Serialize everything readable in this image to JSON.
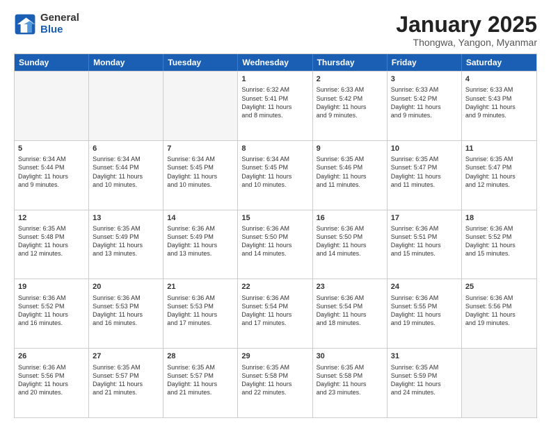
{
  "logo": {
    "general": "General",
    "blue": "Blue"
  },
  "title": "January 2025",
  "location": "Thongwa, Yangon, Myanmar",
  "header_days": [
    "Sunday",
    "Monday",
    "Tuesday",
    "Wednesday",
    "Thursday",
    "Friday",
    "Saturday"
  ],
  "weeks": [
    [
      {
        "day": "",
        "lines": [],
        "empty": true
      },
      {
        "day": "",
        "lines": [],
        "empty": true
      },
      {
        "day": "",
        "lines": [],
        "empty": true
      },
      {
        "day": "1",
        "lines": [
          "Sunrise: 6:32 AM",
          "Sunset: 5:41 PM",
          "Daylight: 11 hours",
          "and 8 minutes."
        ],
        "empty": false
      },
      {
        "day": "2",
        "lines": [
          "Sunrise: 6:33 AM",
          "Sunset: 5:42 PM",
          "Daylight: 11 hours",
          "and 9 minutes."
        ],
        "empty": false
      },
      {
        "day": "3",
        "lines": [
          "Sunrise: 6:33 AM",
          "Sunset: 5:42 PM",
          "Daylight: 11 hours",
          "and 9 minutes."
        ],
        "empty": false
      },
      {
        "day": "4",
        "lines": [
          "Sunrise: 6:33 AM",
          "Sunset: 5:43 PM",
          "Daylight: 11 hours",
          "and 9 minutes."
        ],
        "empty": false
      }
    ],
    [
      {
        "day": "5",
        "lines": [
          "Sunrise: 6:34 AM",
          "Sunset: 5:44 PM",
          "Daylight: 11 hours",
          "and 9 minutes."
        ],
        "empty": false
      },
      {
        "day": "6",
        "lines": [
          "Sunrise: 6:34 AM",
          "Sunset: 5:44 PM",
          "Daylight: 11 hours",
          "and 10 minutes."
        ],
        "empty": false
      },
      {
        "day": "7",
        "lines": [
          "Sunrise: 6:34 AM",
          "Sunset: 5:45 PM",
          "Daylight: 11 hours",
          "and 10 minutes."
        ],
        "empty": false
      },
      {
        "day": "8",
        "lines": [
          "Sunrise: 6:34 AM",
          "Sunset: 5:45 PM",
          "Daylight: 11 hours",
          "and 10 minutes."
        ],
        "empty": false
      },
      {
        "day": "9",
        "lines": [
          "Sunrise: 6:35 AM",
          "Sunset: 5:46 PM",
          "Daylight: 11 hours",
          "and 11 minutes."
        ],
        "empty": false
      },
      {
        "day": "10",
        "lines": [
          "Sunrise: 6:35 AM",
          "Sunset: 5:47 PM",
          "Daylight: 11 hours",
          "and 11 minutes."
        ],
        "empty": false
      },
      {
        "day": "11",
        "lines": [
          "Sunrise: 6:35 AM",
          "Sunset: 5:47 PM",
          "Daylight: 11 hours",
          "and 12 minutes."
        ],
        "empty": false
      }
    ],
    [
      {
        "day": "12",
        "lines": [
          "Sunrise: 6:35 AM",
          "Sunset: 5:48 PM",
          "Daylight: 11 hours",
          "and 12 minutes."
        ],
        "empty": false
      },
      {
        "day": "13",
        "lines": [
          "Sunrise: 6:35 AM",
          "Sunset: 5:49 PM",
          "Daylight: 11 hours",
          "and 13 minutes."
        ],
        "empty": false
      },
      {
        "day": "14",
        "lines": [
          "Sunrise: 6:36 AM",
          "Sunset: 5:49 PM",
          "Daylight: 11 hours",
          "and 13 minutes."
        ],
        "empty": false
      },
      {
        "day": "15",
        "lines": [
          "Sunrise: 6:36 AM",
          "Sunset: 5:50 PM",
          "Daylight: 11 hours",
          "and 14 minutes."
        ],
        "empty": false
      },
      {
        "day": "16",
        "lines": [
          "Sunrise: 6:36 AM",
          "Sunset: 5:50 PM",
          "Daylight: 11 hours",
          "and 14 minutes."
        ],
        "empty": false
      },
      {
        "day": "17",
        "lines": [
          "Sunrise: 6:36 AM",
          "Sunset: 5:51 PM",
          "Daylight: 11 hours",
          "and 15 minutes."
        ],
        "empty": false
      },
      {
        "day": "18",
        "lines": [
          "Sunrise: 6:36 AM",
          "Sunset: 5:52 PM",
          "Daylight: 11 hours",
          "and 15 minutes."
        ],
        "empty": false
      }
    ],
    [
      {
        "day": "19",
        "lines": [
          "Sunrise: 6:36 AM",
          "Sunset: 5:52 PM",
          "Daylight: 11 hours",
          "and 16 minutes."
        ],
        "empty": false
      },
      {
        "day": "20",
        "lines": [
          "Sunrise: 6:36 AM",
          "Sunset: 5:53 PM",
          "Daylight: 11 hours",
          "and 16 minutes."
        ],
        "empty": false
      },
      {
        "day": "21",
        "lines": [
          "Sunrise: 6:36 AM",
          "Sunset: 5:53 PM",
          "Daylight: 11 hours",
          "and 17 minutes."
        ],
        "empty": false
      },
      {
        "day": "22",
        "lines": [
          "Sunrise: 6:36 AM",
          "Sunset: 5:54 PM",
          "Daylight: 11 hours",
          "and 17 minutes."
        ],
        "empty": false
      },
      {
        "day": "23",
        "lines": [
          "Sunrise: 6:36 AM",
          "Sunset: 5:54 PM",
          "Daylight: 11 hours",
          "and 18 minutes."
        ],
        "empty": false
      },
      {
        "day": "24",
        "lines": [
          "Sunrise: 6:36 AM",
          "Sunset: 5:55 PM",
          "Daylight: 11 hours",
          "and 19 minutes."
        ],
        "empty": false
      },
      {
        "day": "25",
        "lines": [
          "Sunrise: 6:36 AM",
          "Sunset: 5:56 PM",
          "Daylight: 11 hours",
          "and 19 minutes."
        ],
        "empty": false
      }
    ],
    [
      {
        "day": "26",
        "lines": [
          "Sunrise: 6:36 AM",
          "Sunset: 5:56 PM",
          "Daylight: 11 hours",
          "and 20 minutes."
        ],
        "empty": false
      },
      {
        "day": "27",
        "lines": [
          "Sunrise: 6:35 AM",
          "Sunset: 5:57 PM",
          "Daylight: 11 hours",
          "and 21 minutes."
        ],
        "empty": false
      },
      {
        "day": "28",
        "lines": [
          "Sunrise: 6:35 AM",
          "Sunset: 5:57 PM",
          "Daylight: 11 hours",
          "and 21 minutes."
        ],
        "empty": false
      },
      {
        "day": "29",
        "lines": [
          "Sunrise: 6:35 AM",
          "Sunset: 5:58 PM",
          "Daylight: 11 hours",
          "and 22 minutes."
        ],
        "empty": false
      },
      {
        "day": "30",
        "lines": [
          "Sunrise: 6:35 AM",
          "Sunset: 5:58 PM",
          "Daylight: 11 hours",
          "and 23 minutes."
        ],
        "empty": false
      },
      {
        "day": "31",
        "lines": [
          "Sunrise: 6:35 AM",
          "Sunset: 5:59 PM",
          "Daylight: 11 hours",
          "and 24 minutes."
        ],
        "empty": false
      },
      {
        "day": "",
        "lines": [],
        "empty": true
      }
    ]
  ]
}
